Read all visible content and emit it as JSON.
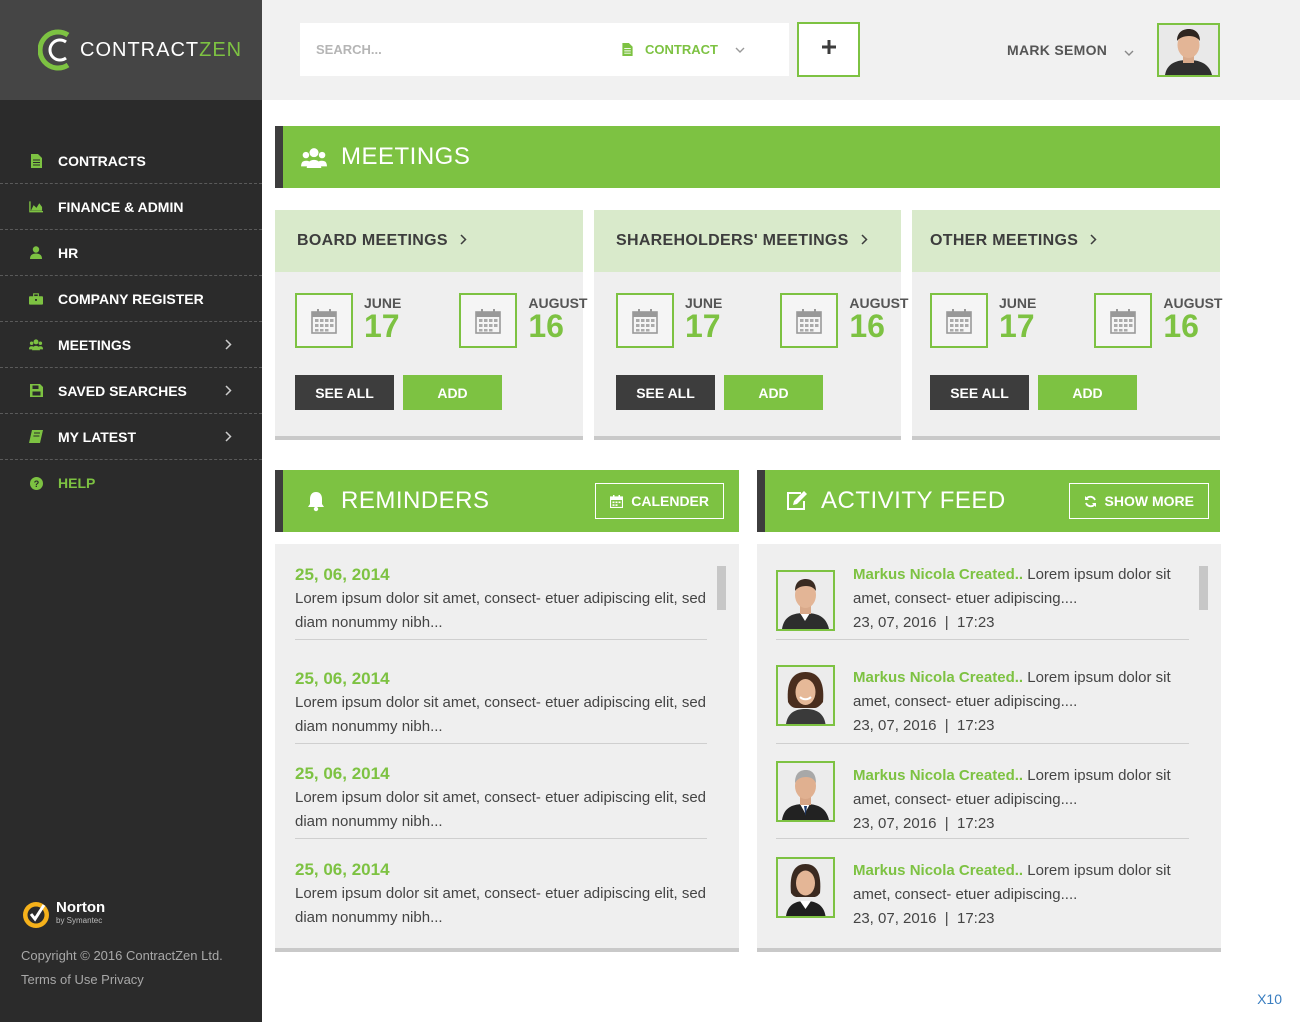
{
  "brand": {
    "name_part1": "CONTRACT",
    "name_part2": "ZEN"
  },
  "colors": {
    "accent": "#7dc242",
    "sidebar": "#2b2b2b",
    "dark_button": "#3d3d3d",
    "light_green": "#d9eacb"
  },
  "sidebar": {
    "items": [
      {
        "label": "CONTRACTS",
        "icon": "document-icon"
      },
      {
        "label": "FINANCE & ADMIN",
        "icon": "area-chart-icon"
      },
      {
        "label": "HR",
        "icon": "user-icon"
      },
      {
        "label": "COMPANY REGISTER",
        "icon": "briefcase-icon"
      },
      {
        "label": "MEETINGS",
        "icon": "users-icon"
      },
      {
        "label": "SAVED SEARCHES",
        "icon": "save-icon"
      },
      {
        "label": "MY LATEST",
        "icon": "book-icon"
      },
      {
        "label": "HELP",
        "icon": "question-icon"
      }
    ],
    "norton": {
      "name": "Norton",
      "sub": "by Symantec"
    },
    "copyright": "Copyright © 2016 ContractZen Ltd.",
    "links": "Terms of Use Privacy"
  },
  "topbar": {
    "search_placeholder": "SEARCH...",
    "contract_label": "CONTRACT",
    "add_label": "+",
    "user_name": "MARK SEMON"
  },
  "meetings": {
    "title": "MEETINGS",
    "cards": [
      {
        "title": "BOARD MEETINGS",
        "dates": [
          {
            "month": "JUNE",
            "day": "17"
          },
          {
            "month": "AUGUST",
            "day": "16"
          }
        ],
        "see_all": "SEE ALL",
        "add": "ADD"
      },
      {
        "title": "SHAREHOLDERS' MEETINGS",
        "dates": [
          {
            "month": "JUNE",
            "day": "17"
          },
          {
            "month": "AUGUST",
            "day": "16"
          }
        ],
        "see_all": "SEE ALL",
        "add": "ADD"
      },
      {
        "title": "OTHER MEETINGS",
        "dates": [
          {
            "month": "JUNE",
            "day": "17"
          },
          {
            "month": "AUGUST",
            "day": "16"
          }
        ],
        "see_all": "SEE ALL",
        "add": "ADD"
      }
    ]
  },
  "reminders": {
    "title": "REMINDERS",
    "calendar_button": "CALENDER",
    "items": [
      {
        "date": "25, 06, 2014",
        "text": "Lorem ipsum dolor sit amet, consect- etuer adipiscing elit, sed diam nonummy nibh..."
      },
      {
        "date": "25, 06, 2014",
        "text": "Lorem ipsum dolor sit amet, consect- etuer adipiscing elit, sed diam nonummy nibh..."
      },
      {
        "date": "25, 06, 2014",
        "text": "Lorem ipsum dolor sit amet, consect- etuer adipiscing elit, sed diam nonummy nibh..."
      },
      {
        "date": "25, 06, 2014",
        "text": "Lorem ipsum dolor sit amet, consect- etuer adipiscing elit, sed diam nonummy nibh..."
      }
    ]
  },
  "activity": {
    "title": "ACTIVITY FEED",
    "show_more": "SHOW MORE",
    "items": [
      {
        "name": "Markus Nicola Created..",
        "text": " Lorem ipsum dolor sit amet, consect- etuer adipiscing....",
        "time": "23, 07, 2016  |  17:23"
      },
      {
        "name": "Markus Nicola Created..",
        "text": " Lorem ipsum dolor sit amet, consect- etuer adipiscing....",
        "time": "23, 07, 2016  |  17:23"
      },
      {
        "name": "Markus Nicola Created..",
        "text": " Lorem ipsum dolor sit amet, consect- etuer adipiscing....",
        "time": "23, 07, 2016  |  17:23"
      },
      {
        "name": "Markus Nicola Created..",
        "text": " Lorem ipsum dolor sit amet, consect- etuer adipiscing....",
        "time": "23, 07, 2016  |  17:23"
      }
    ]
  },
  "corner_label": "X10"
}
